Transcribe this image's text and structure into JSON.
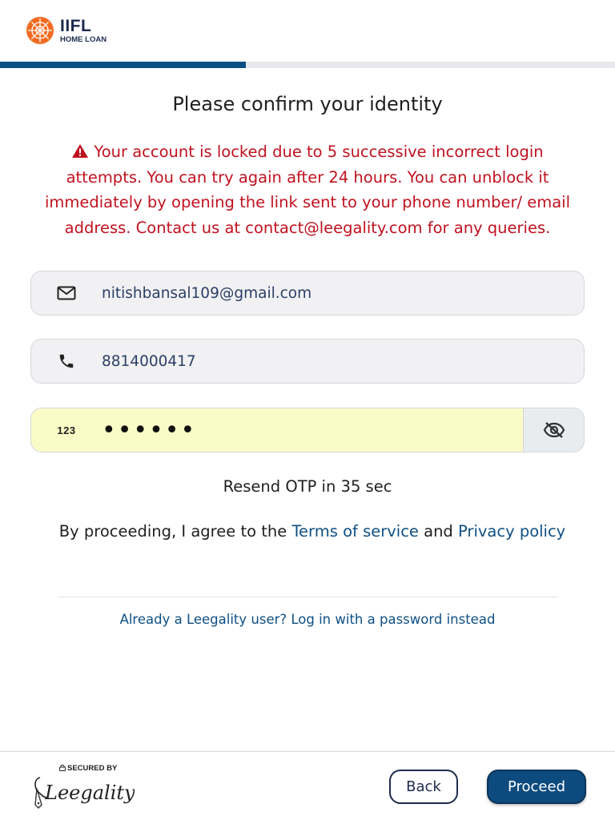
{
  "header": {
    "logo_title": "IIFL",
    "logo_subtitle": "HOME LOAN",
    "progress_fraction": 0.4
  },
  "main": {
    "title": "Please confirm your identity",
    "alert_message": "Your account is locked due to 5 successive incorrect login attempts. You can try again after 24 hours. You can unblock it immediately by opening the link sent to your phone number/ email address. Contact us at contact@leegality.com for any queries.",
    "email_value": "nitishbansal109@gmail.com",
    "phone_value": "8814000417",
    "otp_icon_text": "123",
    "otp_value": "••••••",
    "resend_text": "Resend OTP in 35 sec",
    "agree_prefix": "By proceeding, I agree to the ",
    "terms_link": "Terms of service",
    "agree_and": " and ",
    "privacy_link": "Privacy policy",
    "alt_login_link": "Already a Leegality user? Log in with a password instead"
  },
  "footer": {
    "secured_label": "SECURED BY",
    "brand_name": "Leegality",
    "back_label": "Back",
    "proceed_label": "Proceed"
  },
  "colors": {
    "alert": "#c0121f",
    "link": "#0f4f84",
    "primary": "#0d4a7e",
    "otp_field_bg": "#fbfbc8",
    "logo_orange": "#f26b21"
  },
  "icons": {
    "email": "envelope-icon",
    "phone": "phone-icon",
    "otp": "numeric-icon",
    "toggle": "eye-off-icon",
    "alert": "warning-icon"
  }
}
